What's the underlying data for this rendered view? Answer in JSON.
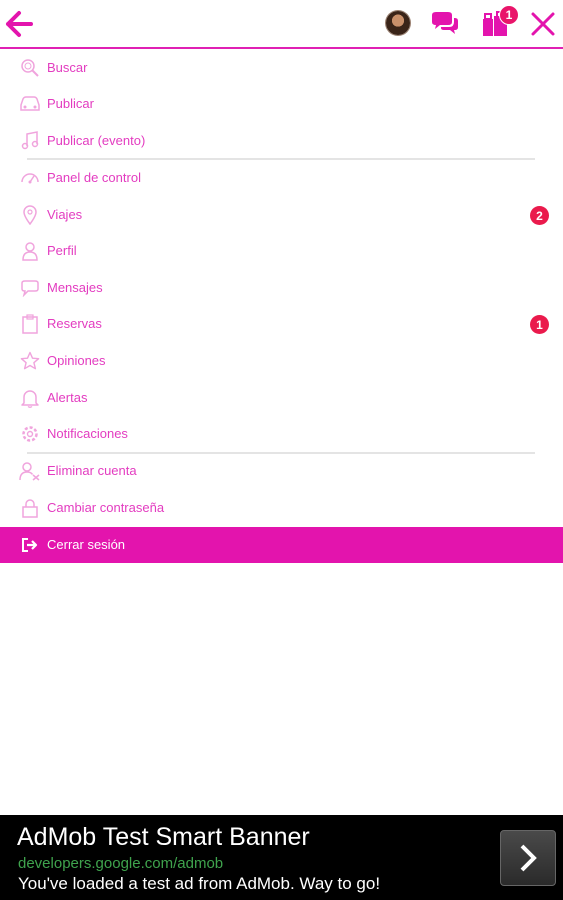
{
  "colors": {
    "accent": "#e314ad",
    "menu_text": "#e33cc0",
    "badge": "#ea1a4c",
    "ad_url": "#3fa34d"
  },
  "header": {
    "back_icon": "arrow-left-icon",
    "avatar": "user-avatar",
    "chat_icon": "chat-bubbles-icon",
    "bookings_icon": "luggage-icon",
    "bookings_badge": "1",
    "close_icon": "close-icon"
  },
  "menu": {
    "group1": [
      {
        "label": "Buscar",
        "icon": "search-icon"
      },
      {
        "label": "Publicar",
        "icon": "car-icon"
      },
      {
        "label": "Publicar (evento)",
        "icon": "music-icon"
      }
    ],
    "group2": [
      {
        "label": "Panel de control",
        "icon": "dashboard-icon"
      },
      {
        "label": "Viajes",
        "icon": "location-pin-icon",
        "badge": "2"
      },
      {
        "label": "Perfil",
        "icon": "user-icon"
      },
      {
        "label": "Mensajes",
        "icon": "chat-icon"
      },
      {
        "label": "Reservas",
        "icon": "clipboard-icon",
        "badge": "1"
      },
      {
        "label": "Opiniones",
        "icon": "star-icon"
      },
      {
        "label": "Alertas",
        "icon": "bell-icon"
      },
      {
        "label": "Notificaciones",
        "icon": "gear-icon"
      }
    ],
    "group3": [
      {
        "label": "Eliminar cuenta",
        "icon": "user-remove-icon"
      },
      {
        "label": "Cambiar contraseña",
        "icon": "lock-icon"
      }
    ],
    "logout": {
      "label": "Cerrar sesión",
      "icon": "sign-out-icon"
    }
  },
  "ad": {
    "title": "AdMob Test Smart Banner",
    "url": "developers.google.com/admob",
    "description": "You've loaded a test ad from AdMob. Way to go!",
    "arrow_icon": "chevron-right-icon"
  }
}
